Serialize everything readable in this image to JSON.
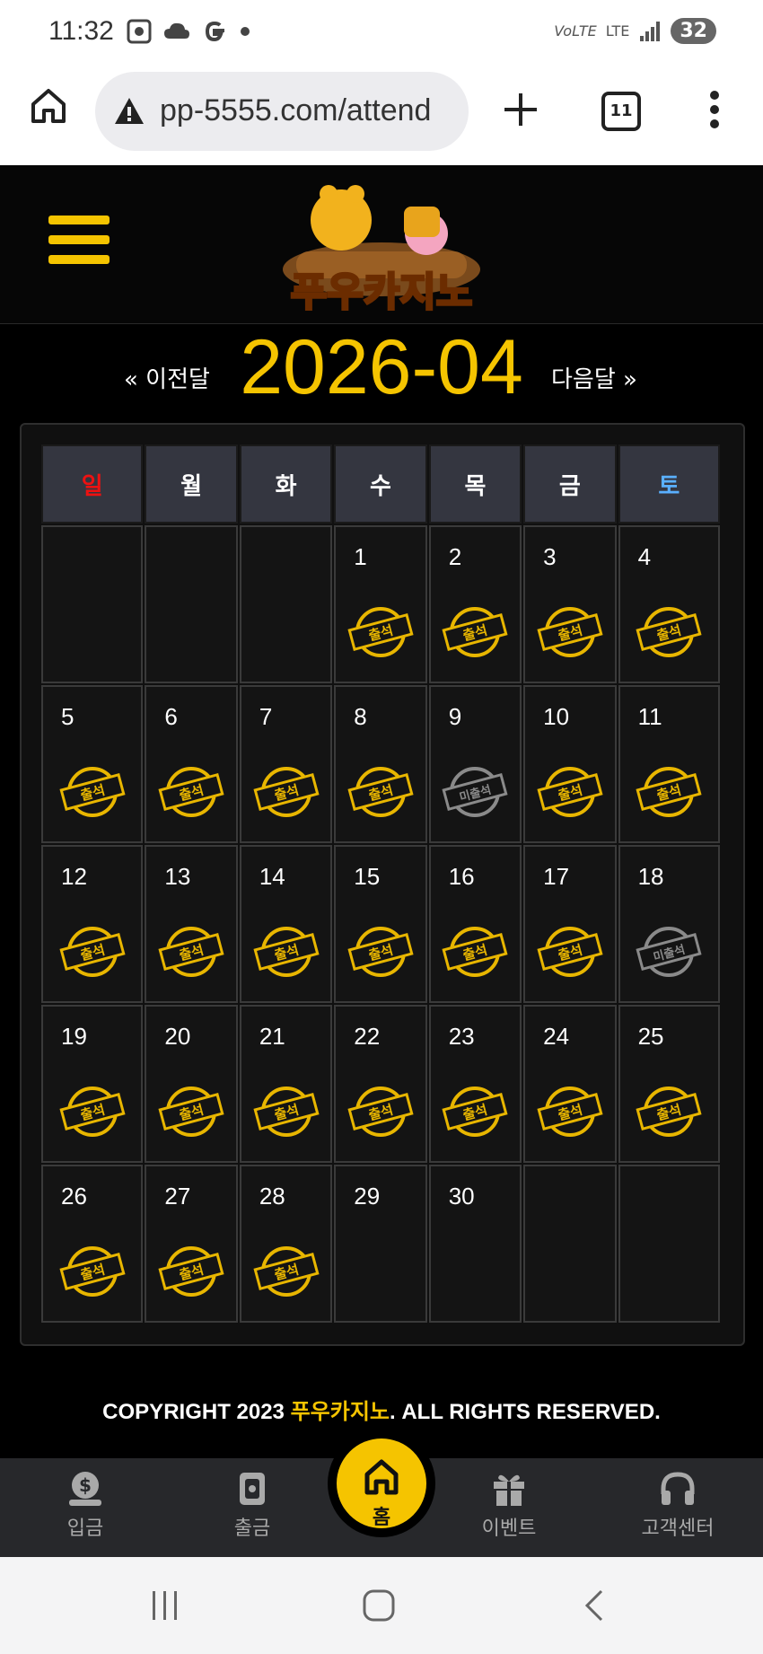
{
  "status_bar": {
    "time": "11:32",
    "battery": "32",
    "network": "LTE"
  },
  "browser": {
    "url": "pp-5555.com/attend",
    "tab_count": "11"
  },
  "header": {
    "logo_text": "푸우카지노"
  },
  "month_nav": {
    "prev_label": "« 이전달",
    "current": "2026-04",
    "next_label": "다음달 »"
  },
  "calendar": {
    "weekdays": [
      "일",
      "월",
      "화",
      "수",
      "목",
      "금",
      "토"
    ],
    "weeks": [
      [
        null,
        null,
        null,
        {
          "day": "1",
          "status": "attended"
        },
        {
          "day": "2",
          "status": "attended"
        },
        {
          "day": "3",
          "status": "attended"
        },
        {
          "day": "4",
          "status": "attended"
        }
      ],
      [
        {
          "day": "5",
          "status": "attended"
        },
        {
          "day": "6",
          "status": "attended"
        },
        {
          "day": "7",
          "status": "attended"
        },
        {
          "day": "8",
          "status": "attended"
        },
        {
          "day": "9",
          "status": "absent"
        },
        {
          "day": "10",
          "status": "attended"
        },
        {
          "day": "11",
          "status": "attended"
        }
      ],
      [
        {
          "day": "12",
          "status": "attended"
        },
        {
          "day": "13",
          "status": "attended"
        },
        {
          "day": "14",
          "status": "attended"
        },
        {
          "day": "15",
          "status": "attended"
        },
        {
          "day": "16",
          "status": "attended"
        },
        {
          "day": "17",
          "status": "attended"
        },
        {
          "day": "18",
          "status": "absent"
        }
      ],
      [
        {
          "day": "19",
          "status": "attended"
        },
        {
          "day": "20",
          "status": "attended"
        },
        {
          "day": "21",
          "status": "attended"
        },
        {
          "day": "22",
          "status": "attended"
        },
        {
          "day": "23",
          "status": "attended"
        },
        {
          "day": "24",
          "status": "attended"
        },
        {
          "day": "25",
          "status": "attended"
        }
      ],
      [
        {
          "day": "26",
          "status": "attended"
        },
        {
          "day": "27",
          "status": "attended"
        },
        {
          "day": "28",
          "status": "attended"
        },
        {
          "day": "29",
          "status": ""
        },
        {
          "day": "30",
          "status": ""
        },
        null,
        null
      ]
    ],
    "stamp_attended": "출석",
    "stamp_absent": "미출석"
  },
  "footer": {
    "copyright_prefix": "COPYRIGHT 2023 ",
    "brand": "푸우카지노",
    "copyright_suffix": ". ALL RIGHTS RESERVED."
  },
  "bottom_nav": {
    "deposit": "입금",
    "withdraw": "출금",
    "home": "홈",
    "event": "이벤트",
    "support": "고객센터"
  },
  "colors": {
    "accent": "#f5c400",
    "sunday": "#ee1111",
    "saturday": "#5ab0ff",
    "stamp_gold": "#e8b600",
    "stamp_gray": "#8a8a8a"
  }
}
